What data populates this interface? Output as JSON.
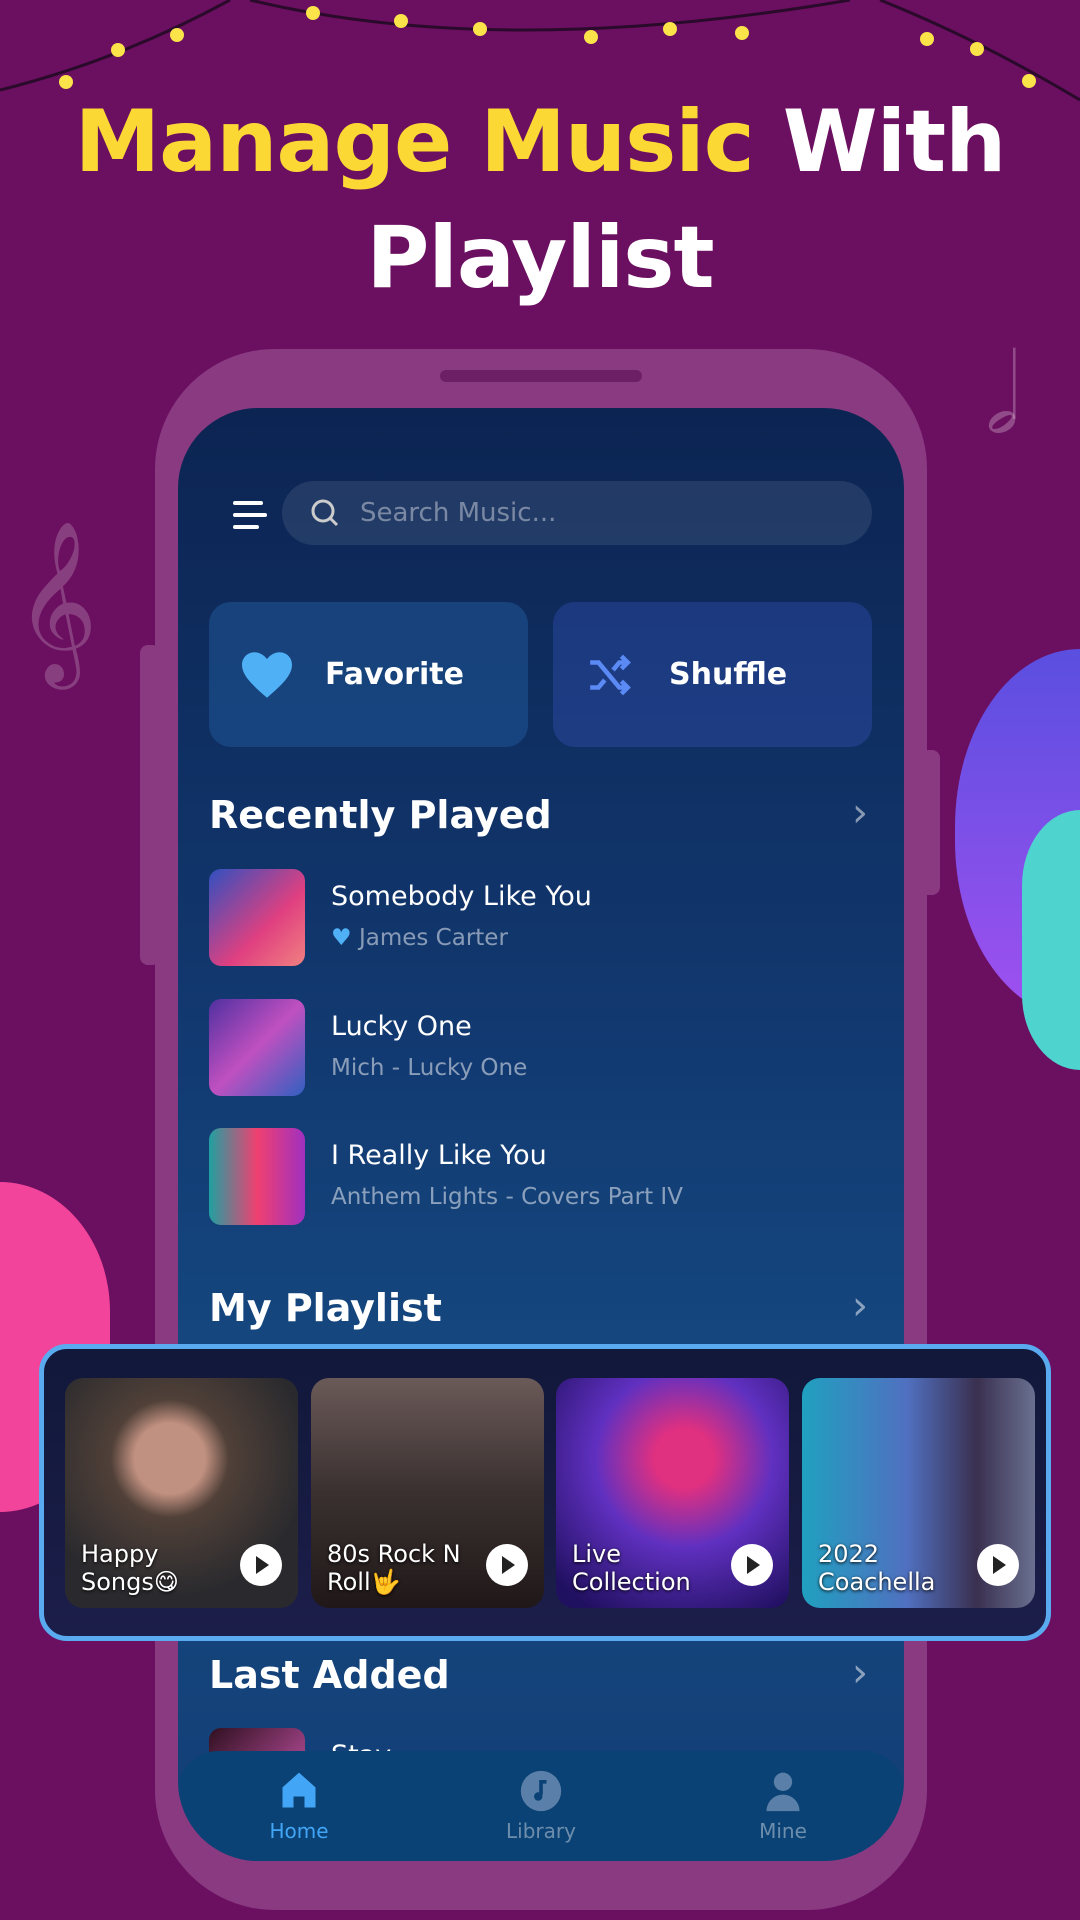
{
  "headline": {
    "part1": "Manage Music",
    "part2": "With",
    "line2": "Playlist"
  },
  "colors": {
    "accent_yellow": "#fcd835",
    "background": "#6b0f60",
    "highlight_border": "#5aaaf0",
    "active_tab": "#42a5f5"
  },
  "search": {
    "placeholder": "Search Music..."
  },
  "quick_actions": [
    {
      "label": "Favorite",
      "icon": "heart-icon"
    },
    {
      "label": "Shuffle",
      "icon": "shuffle-icon"
    }
  ],
  "recently_played": {
    "title": "Recently Played",
    "items": [
      {
        "title": "Somebody Like You",
        "subtitle": "James Carter",
        "favorite": true
      },
      {
        "title": "Lucky One",
        "subtitle": "Mich - Lucky One"
      },
      {
        "title": "I Really Like You",
        "subtitle": "Anthem Lights - Covers Part IV"
      }
    ]
  },
  "my_playlist": {
    "title": "My Playlist",
    "items": [
      {
        "line1": "Happy",
        "line2": "Songs😋"
      },
      {
        "line1": "80s Rock N",
        "line2": "Roll🤟"
      },
      {
        "line1": "Live",
        "line2": "Collection"
      },
      {
        "line1": "2022",
        "line2": "Coachella"
      }
    ]
  },
  "last_added": {
    "title": "Last Added",
    "items": [
      {
        "title": "Stay"
      }
    ]
  },
  "nav": [
    {
      "label": "Home",
      "icon": "home-icon",
      "active": true
    },
    {
      "label": "Library",
      "icon": "music-note-icon"
    },
    {
      "label": "Mine",
      "icon": "user-icon"
    }
  ]
}
